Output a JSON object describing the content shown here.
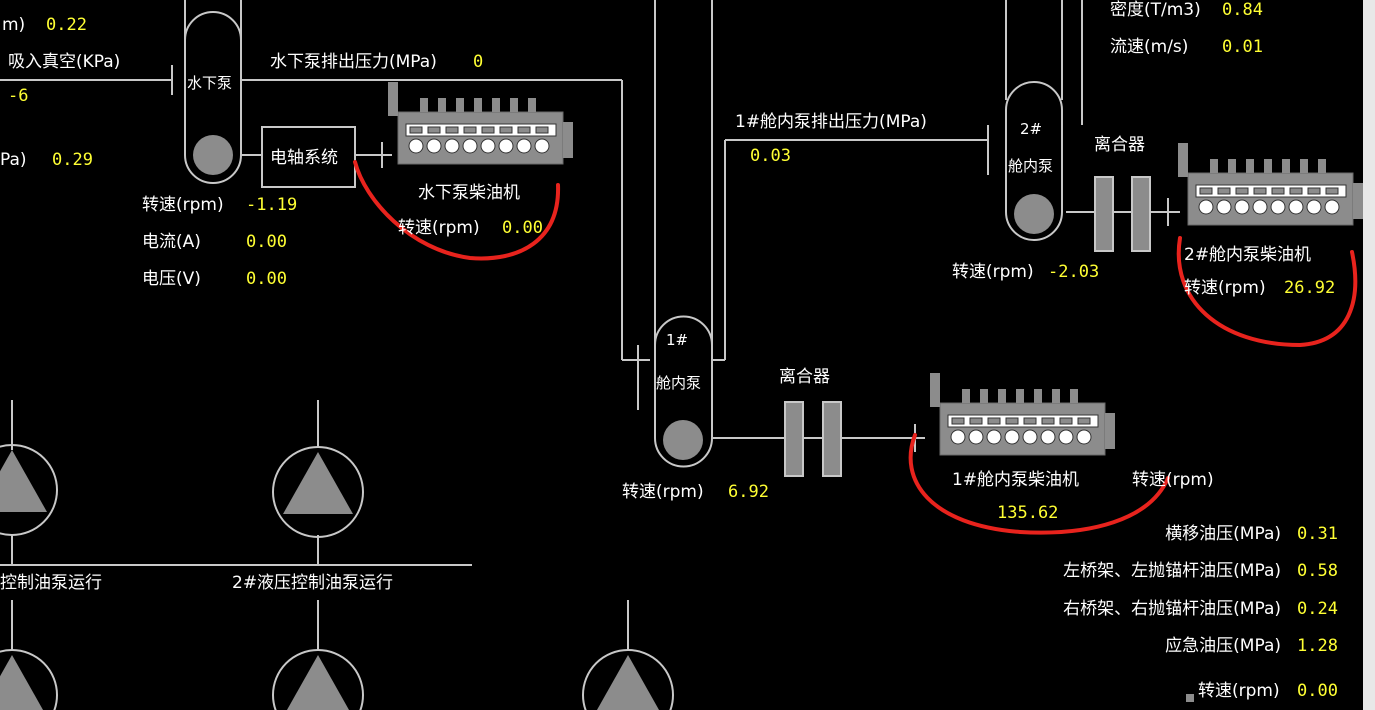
{
  "colors": {
    "background": "#000000",
    "label": "#ffffff",
    "value": "#ffff33",
    "line": "#c8c8c8",
    "equipment": "#8c8c8c",
    "annotation": "#e8231d"
  },
  "underwater": {
    "suction_unit_fragment": "m)",
    "suction_value_top": "0.22",
    "vacuum_label": "吸入真空(KPa)",
    "vacuum_value": "-6",
    "pressure_unit_fragment": "Pa)",
    "pressure_value": "0.29",
    "pump_label": "水下泵",
    "discharge_label": "水下泵排出压力(MPa)",
    "discharge_value": "0",
    "shaft_system_label": "电轴系统",
    "speed_label": "转速(rpm)",
    "speed_value": "-1.19",
    "current_label": "电流(A)",
    "current_value": "0.00",
    "voltage_label": "电压(V)",
    "voltage_value": "0.00",
    "diesel_label": "水下泵柴油机",
    "diesel_speed_label": "转速(rpm)",
    "diesel_speed_value": "0.00"
  },
  "pump1": {
    "label_line1": "1#",
    "label_line2": "舱内泵",
    "discharge_label": "1#舱内泵排出压力(MPa)",
    "discharge_value": "0.03",
    "speed_label": "转速(rpm)",
    "speed_value": "6.92",
    "clutch_label": "离合器",
    "diesel_label": "1#舱内泵柴油机",
    "diesel_speed_label": "转速(rpm)",
    "diesel_speed_value": "135.62"
  },
  "pump2": {
    "density_label": "密度(T/m3)",
    "density_value": "0.84",
    "flow_label": "流速(m/s)",
    "flow_value": "0.01",
    "label_line1": "2#",
    "label_line2": "舱内泵",
    "clutch_label": "离合器",
    "speed_label": "转速(rpm)",
    "speed_value": "-2.03",
    "diesel_label": "2#舱内泵柴油机",
    "diesel_speed_label": "转速(rpm)",
    "diesel_speed_value": "26.92"
  },
  "hydraulics": {
    "pump1_running_label": "控制油泵运行",
    "pump2_running_label": "2#液压控制油泵运行",
    "traverse_label": "横移油压(MPa)",
    "traverse_value": "0.31",
    "left_bridge_label": "左桥架、左抛锚杆油压(MPa)",
    "left_bridge_value": "0.58",
    "right_bridge_label": "右桥架、右抛锚杆油压(MPa)",
    "right_bridge_value": "0.24",
    "emergency_label": "应急油压(MPa)",
    "emergency_value": "1.28",
    "bottom_speed_label": "转速(rpm)",
    "bottom_speed_value": "0.00"
  }
}
